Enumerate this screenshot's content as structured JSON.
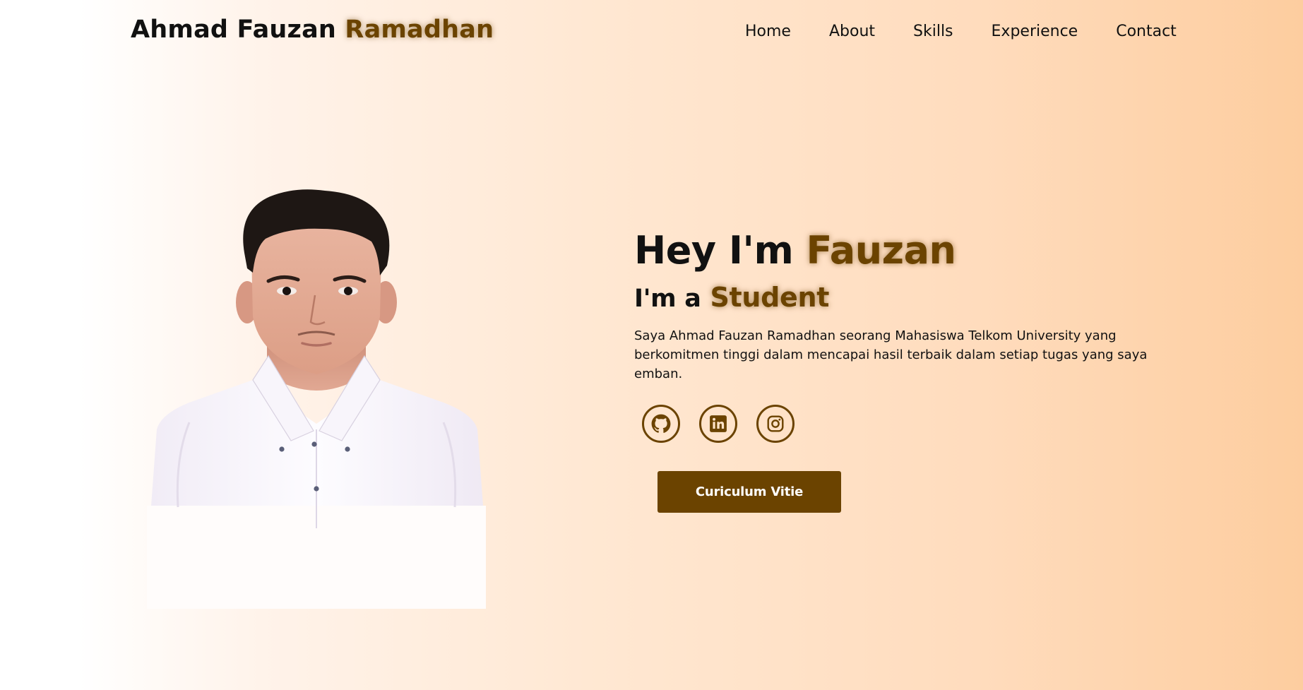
{
  "header": {
    "logo_name": "Ahmad Fauzan",
    "logo_accent": "Ramadhan"
  },
  "nav": {
    "items": [
      {
        "label": "Home"
      },
      {
        "label": "About"
      },
      {
        "label": "Skills"
      },
      {
        "label": "Experience"
      },
      {
        "label": "Contact"
      }
    ]
  },
  "hero": {
    "greeting": "Hey I'm",
    "name": "Fauzan",
    "role_prefix": "I'm a",
    "role": "Student",
    "description": "Saya Ahmad Fauzan Ramadhan seorang Mahasiswa Telkom University yang berkomitmen tinggi dalam mencapai hasil terbaik dalam setiap tugas yang saya emban."
  },
  "socials": [
    {
      "icon": "github-icon"
    },
    {
      "icon": "linkedin-icon"
    },
    {
      "icon": "instagram-icon"
    }
  ],
  "cta": {
    "cv_label": "Curiculum Vitie"
  },
  "colors": {
    "accent": "#6b4300",
    "gradient_start": "#ffffff",
    "gradient_end": "#fdcd9f",
    "text": "#111111"
  }
}
